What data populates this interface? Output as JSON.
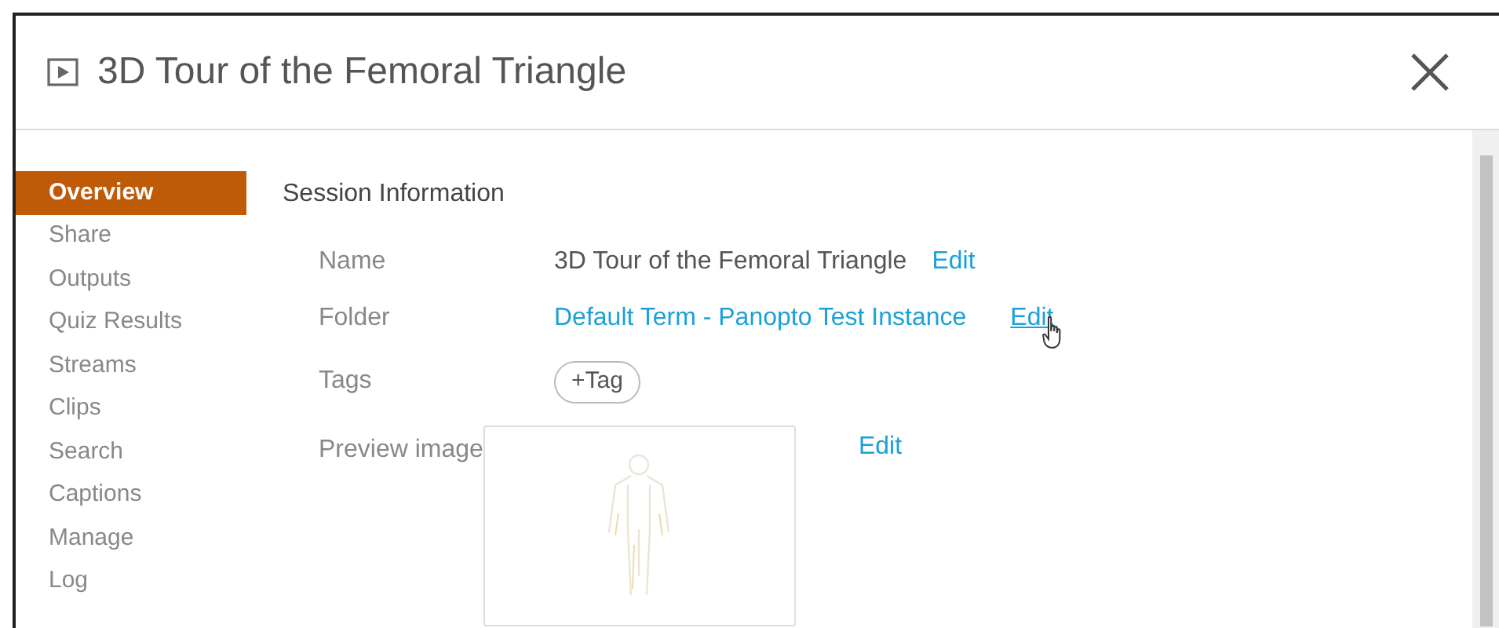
{
  "dialog": {
    "title": "3D Tour of the Femoral Triangle"
  },
  "sidebar": {
    "items": [
      {
        "label": "Overview",
        "selected": true
      },
      {
        "label": "Share",
        "selected": false
      },
      {
        "label": "Outputs",
        "selected": false
      },
      {
        "label": "Quiz Results",
        "selected": false
      },
      {
        "label": "Streams",
        "selected": false
      },
      {
        "label": "Clips",
        "selected": false
      },
      {
        "label": "Search",
        "selected": false
      },
      {
        "label": "Captions",
        "selected": false
      },
      {
        "label": "Manage",
        "selected": false
      },
      {
        "label": "Log",
        "selected": false
      }
    ]
  },
  "section": {
    "heading": "Session Information",
    "fields": [
      {
        "kind": "text",
        "label": "Name",
        "value": "3D Tour of the Femoral Triangle",
        "edit": {
          "label": "Edit",
          "hovered": false
        }
      },
      {
        "kind": "link",
        "label": "Folder",
        "value": "Default Term - Panopto Test Instance",
        "edit": {
          "label": "Edit",
          "hovered": true
        }
      },
      {
        "kind": "tags",
        "label": "Tags",
        "button": "+Tag"
      },
      {
        "kind": "image",
        "label": "Preview image",
        "edit": {
          "label": "Edit",
          "hovered": false
        }
      }
    ]
  }
}
